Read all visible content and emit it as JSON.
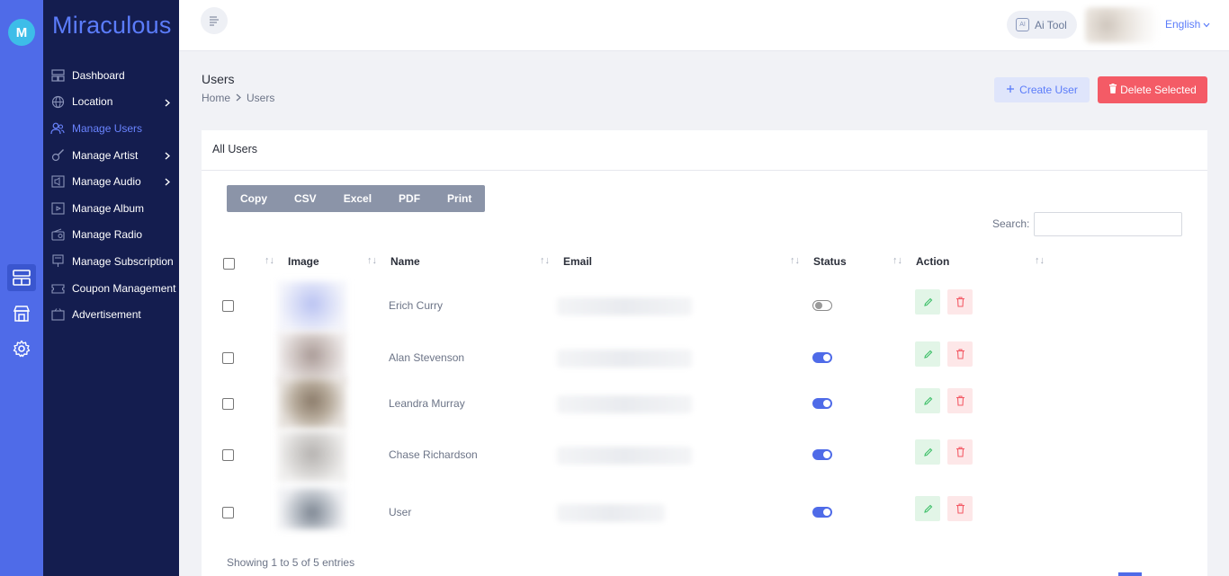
{
  "rail": {
    "logo_letter": "M"
  },
  "sidebar": {
    "brand": "Miraculous",
    "items": [
      {
        "label": "Dashboard"
      },
      {
        "label": "Location"
      },
      {
        "label": "Manage Users"
      },
      {
        "label": "Manage Artist"
      },
      {
        "label": "Manage Audio"
      },
      {
        "label": "Manage Album"
      },
      {
        "label": "Manage Radio"
      },
      {
        "label": "Manage Subscription"
      },
      {
        "label": "Coupon Management"
      },
      {
        "label": "Advertisement"
      }
    ]
  },
  "header": {
    "ai_tool": "Ai Tool",
    "language": "English"
  },
  "page": {
    "title": "Users",
    "breadcrumb": [
      "Home",
      "Users"
    ],
    "create_button": "Create User",
    "delete_button": "Delete Selected"
  },
  "card": {
    "title": "All Users",
    "export_buttons": [
      "Copy",
      "CSV",
      "Excel",
      "PDF",
      "Print"
    ],
    "search_label": "Search:",
    "columns": [
      "Image",
      "Name",
      "Email",
      "Status",
      "Action"
    ],
    "rows": [
      {
        "name": "Erich Curry",
        "status": false
      },
      {
        "name": "Alan Stevenson",
        "status": true
      },
      {
        "name": "Leandra Murray",
        "status": true
      },
      {
        "name": "Chase Richardson",
        "status": true
      },
      {
        "name": "User",
        "status": true
      }
    ],
    "info": "Showing 1 to 5 of 5 entries"
  },
  "colors": {
    "accent": "#4f6be8",
    "sidebar": "#141d4f",
    "danger": "#f45b66"
  }
}
